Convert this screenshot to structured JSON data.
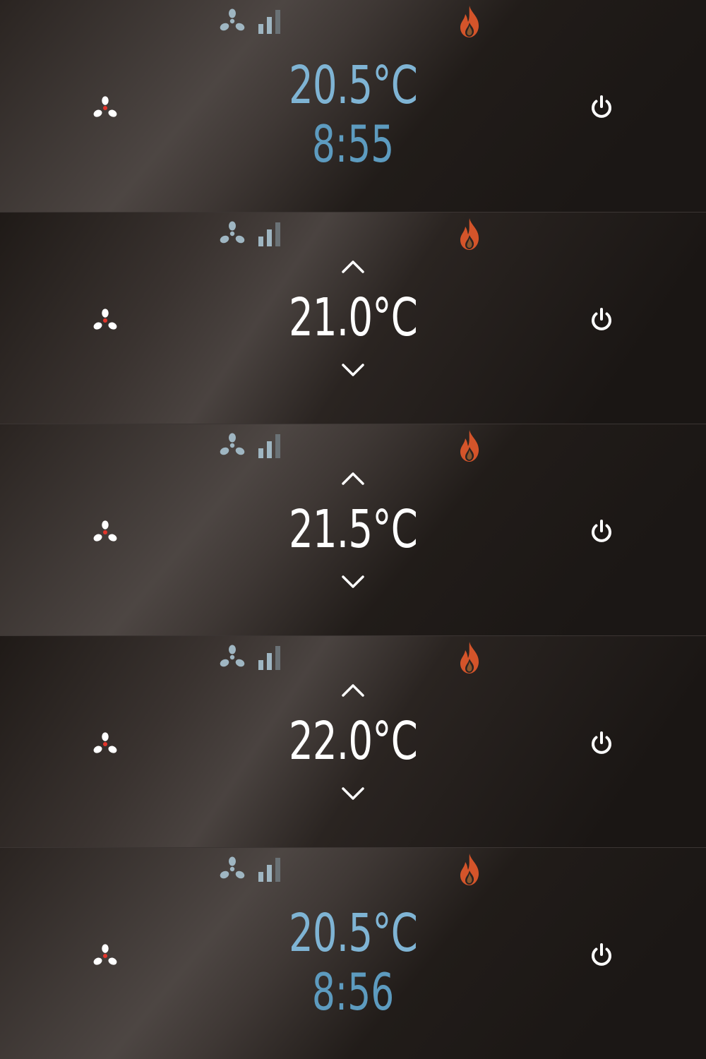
{
  "colors": {
    "status_icon": "#9fb6c2",
    "flame_outer": "#d4542a",
    "flame_inner": "#f08a3a",
    "idle_temp": "#7fb4d4",
    "idle_time": "#5d9bbf",
    "setpoint_temp": "#ffffff",
    "button_icon": "#ffffff",
    "fan_button_accent": "#e3352b"
  },
  "status": {
    "fan_icon": "fan-icon",
    "signal_icon": "signal-bars-icon",
    "signal_level_bars": 2,
    "signal_total_bars": 3,
    "heating_icon": "flame-icon"
  },
  "screens": [
    {
      "mode": "idle",
      "temperature": "20.5°C",
      "time": "8:55"
    },
    {
      "mode": "setpoint",
      "temperature": "21.0°C",
      "up_icon": "chevron-up-icon",
      "down_icon": "chevron-down-icon"
    },
    {
      "mode": "setpoint",
      "temperature": "21.5°C",
      "up_icon": "chevron-up-icon",
      "down_icon": "chevron-down-icon"
    },
    {
      "mode": "setpoint",
      "temperature": "22.0°C",
      "up_icon": "chevron-up-icon",
      "down_icon": "chevron-down-icon"
    },
    {
      "mode": "idle",
      "temperature": "20.5°C",
      "time": "8:56"
    }
  ]
}
